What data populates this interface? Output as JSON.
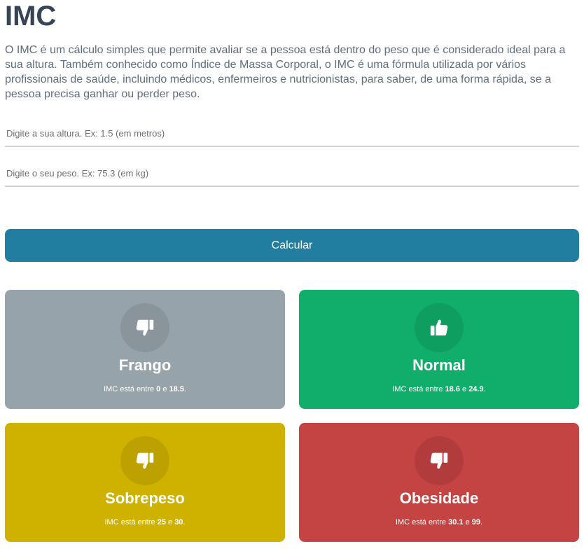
{
  "header": {
    "title": "IMC",
    "description": "O IMC é um cálculo simples que permite avaliar se a pessoa está dentro do peso que é considerado ideal para a sua altura. Também conhecido como Índice de Massa Corporal, o IMC é uma fórmula utilizada por vários profissionais de saúde, incluindo médicos, enfermeiros e nutricionistas, para saber, de uma forma rápida, se a pessoa precisa ganhar ou perder peso."
  },
  "form": {
    "height_placeholder": "Digite a sua altura. Ex: 1.5 (em metros)",
    "height_value": "",
    "weight_placeholder": "Digite o seu peso. Ex: 75.3 (em kg)",
    "weight_value": "",
    "submit_label": "Calcular"
  },
  "categories": [
    {
      "name": "Frango",
      "prefix": "IMC está entre ",
      "min": "0",
      "sep": " e ",
      "max": "18.5",
      "suffix": ".",
      "icon": "thumbs-down-icon",
      "color": "#97a3ab"
    },
    {
      "name": "Normal",
      "prefix": "IMC está entre ",
      "min": "18.6",
      "sep": " e ",
      "max": "24.9",
      "suffix": ".",
      "icon": "thumbs-up-icon",
      "color": "#10ae6a"
    },
    {
      "name": "Sobrepeso",
      "prefix": "IMC está entre ",
      "min": "25",
      "sep": " e ",
      "max": "30",
      "suffix": ".",
      "icon": "thumbs-down-icon",
      "color": "#cfb100"
    },
    {
      "name": "Obesidade",
      "prefix": "IMC está entre ",
      "min": "30.1",
      "sep": " e ",
      "max": "99",
      "suffix": ".",
      "icon": "thumbs-down-icon",
      "color": "#c44343"
    }
  ]
}
